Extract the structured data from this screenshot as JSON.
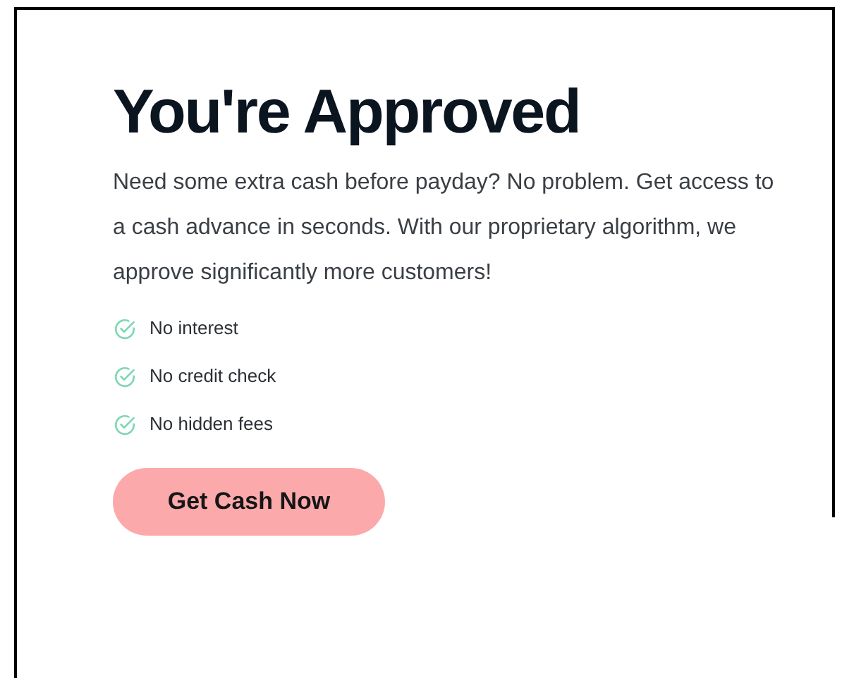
{
  "heading": "You're Approved",
  "description": "Need some extra cash before payday? No problem. Get access to a cash advance in seconds. With our proprietary algorithm, we approve significantly more customers!",
  "features": [
    {
      "label": "No interest"
    },
    {
      "label": "No credit check"
    },
    {
      "label": "No hidden fees"
    }
  ],
  "button": "Get Cash Now"
}
